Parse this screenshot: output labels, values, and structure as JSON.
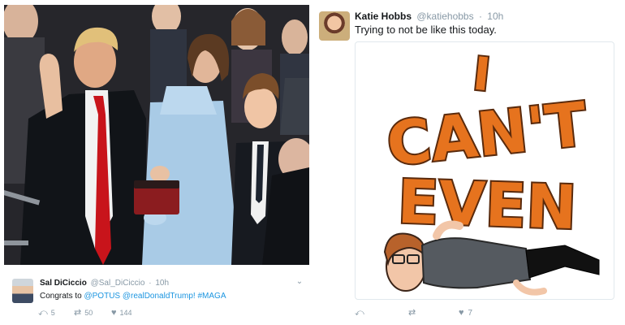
{
  "left_tweet": {
    "author_name": "Sal DiCiccio",
    "author_handle": "@Sal_DiCiccio",
    "time": "10h",
    "text_prefix": "Congrats to ",
    "mention_potus": "@POTUS",
    "mention_trump": "@realDonaldTrump!",
    "hashtag": "#MAGA",
    "actions": {
      "reply_icon": "reply-icon",
      "reply_count": "5",
      "retweet_icon": "retweet-icon",
      "retweet_count": "50",
      "like_icon": "heart-icon",
      "like_count": "144"
    }
  },
  "right_tweet": {
    "author_name": "Katie Hobbs",
    "author_handle": "@katiehobbs",
    "time": "10h",
    "text": "Trying to not be like this today.",
    "media_text": [
      "I",
      "CAN'T",
      "EVEN"
    ],
    "actions": {
      "reply_icon": "reply-icon",
      "retweet_icon": "retweet-icon",
      "like_icon": "heart-icon",
      "like_count": "7"
    }
  },
  "colors": {
    "link": "#1b95e0",
    "muted": "#8899a6",
    "text": "#14171a",
    "cant_even_fill": "#e6731e",
    "cant_even_outline": "#5a2a0c"
  }
}
